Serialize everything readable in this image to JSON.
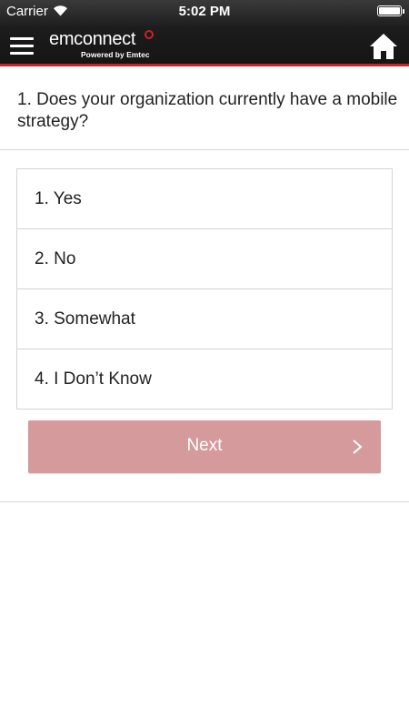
{
  "status_bar": {
    "carrier": "Carrier",
    "time": "5:02 PM",
    "wifi_icon": "wifi-icon",
    "battery_icon": "battery-icon"
  },
  "header": {
    "menu_icon": "hamburger-menu-icon",
    "logo_text": "emconnect",
    "logo_subtitle": "Powered by Emtec",
    "home_icon": "home-icon",
    "accent_color": "#c8222b"
  },
  "question": {
    "text": "1.  Does your organization currently have a mobile strategy?"
  },
  "options": [
    {
      "label": "1. Yes"
    },
    {
      "label": "2. No"
    },
    {
      "label": "3. Somewhat"
    },
    {
      "label": "4. I Don’t Know"
    }
  ],
  "next_button": {
    "label": "Next",
    "color": "#d49a9c",
    "icon": "chevron-right-icon"
  }
}
